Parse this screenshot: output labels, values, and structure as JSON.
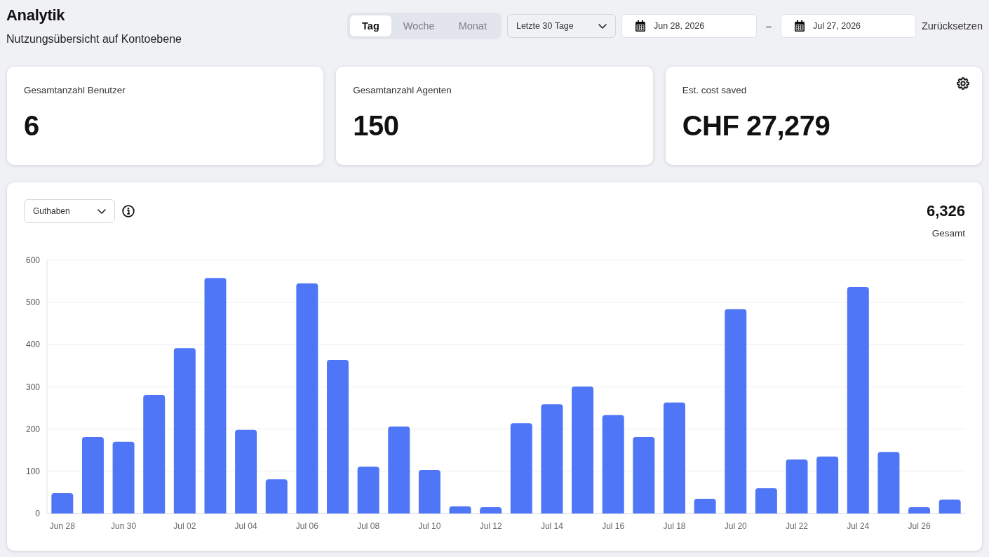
{
  "header": {
    "title": "Analytik",
    "subtitle": "Nutzungsübersicht auf Kontoebene"
  },
  "period_tabs": [
    {
      "label": "Tag",
      "selected": true
    },
    {
      "label": "Woche",
      "selected": false
    },
    {
      "label": "Monat",
      "selected": false
    }
  ],
  "range_dropdown": {
    "value": "Letzte 30 Tage"
  },
  "date_range": {
    "start": "Jun 28, 2026",
    "separator": "–",
    "end": "Jul 27, 2026"
  },
  "reset_link": "Zurücksetzen",
  "stat_cards": [
    {
      "label": "Gesamtanzahl Benutzer",
      "value": "6",
      "settings": false
    },
    {
      "label": "Gesamtanzahl Agenten",
      "value": "150",
      "settings": false
    },
    {
      "label": "Est. cost saved",
      "value": "CHF 27,279",
      "settings": true
    }
  ],
  "chart_panel": {
    "metric_dropdown": {
      "value": "Guthaben"
    },
    "total": {
      "value": "6,326",
      "label": "Gesamt"
    },
    "chart_data": {
      "type": "bar",
      "categories": [
        "Jun 28",
        null,
        "Jun 30",
        null,
        "Jul 02",
        null,
        "Jul 04",
        null,
        "Jul 06",
        null,
        "Jul 08",
        null,
        "Jul 10",
        null,
        "Jul 12",
        null,
        "Jul 14",
        null,
        "Jul 16",
        null,
        "Jul 18",
        null,
        "Jul 20",
        null,
        "Jul 22",
        null,
        "Jul 24",
        null,
        "Jul 26",
        null
      ],
      "values": [
        48,
        181,
        170,
        281,
        392,
        558,
        198,
        81,
        545,
        364,
        111,
        206,
        103,
        17,
        15,
        214,
        259,
        301,
        233,
        181,
        263,
        35,
        484,
        60,
        128,
        135,
        537,
        146,
        15,
        33
      ],
      "ylim": [
        0,
        600
      ],
      "yticks": [
        0,
        100,
        200,
        300,
        400,
        500,
        600
      ],
      "grid": true
    }
  }
}
